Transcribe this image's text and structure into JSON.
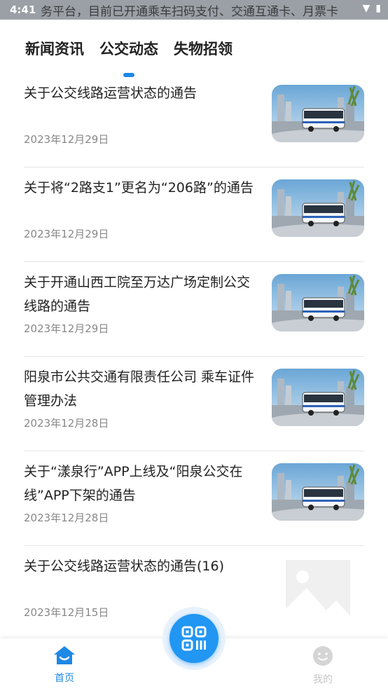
{
  "status_bar": {
    "time": "4:41",
    "ticker_text": "务平台，目前已开通乘车扫码支付、交通互通卡、月票卡"
  },
  "tabs": [
    {
      "label": "新闻资讯",
      "active": false
    },
    {
      "label": "公交动态",
      "active": true
    },
    {
      "label": "失物招领",
      "active": false
    }
  ],
  "news": [
    {
      "title": "关于公交线路运营状态的通告",
      "date": "2023年12月29日",
      "thumbnail": "bus-photo"
    },
    {
      "title": "关于将“2路支1”更名为“206路”的通告",
      "date": "2023年12月29日",
      "thumbnail": "bus-photo"
    },
    {
      "title": "关于开通山西工院至万达广场定制公交线路的通告",
      "date": "2023年12月29日",
      "thumbnail": "bus-photo"
    },
    {
      "title": "阳泉市公共交通有限责任公司 乘车证件管理办法",
      "date": "2023年12月28日",
      "thumbnail": "bus-photo"
    },
    {
      "title": "关于“漾泉行”APP上线及“阳泉公交在线”APP下架的通告",
      "date": "2023年12月28日",
      "thumbnail": "bus-photo"
    },
    {
      "title": "关于公交线路运营状态的通告(16)",
      "date": "2023年12月15日",
      "thumbnail": "image-placeholder"
    }
  ],
  "bottom_nav": {
    "home_label": "首页",
    "mine_label": "我的",
    "scan_icon": "qr-scan-icon"
  },
  "colors": {
    "accent": "#1e88e5",
    "inactive": "#c8c8c8"
  }
}
